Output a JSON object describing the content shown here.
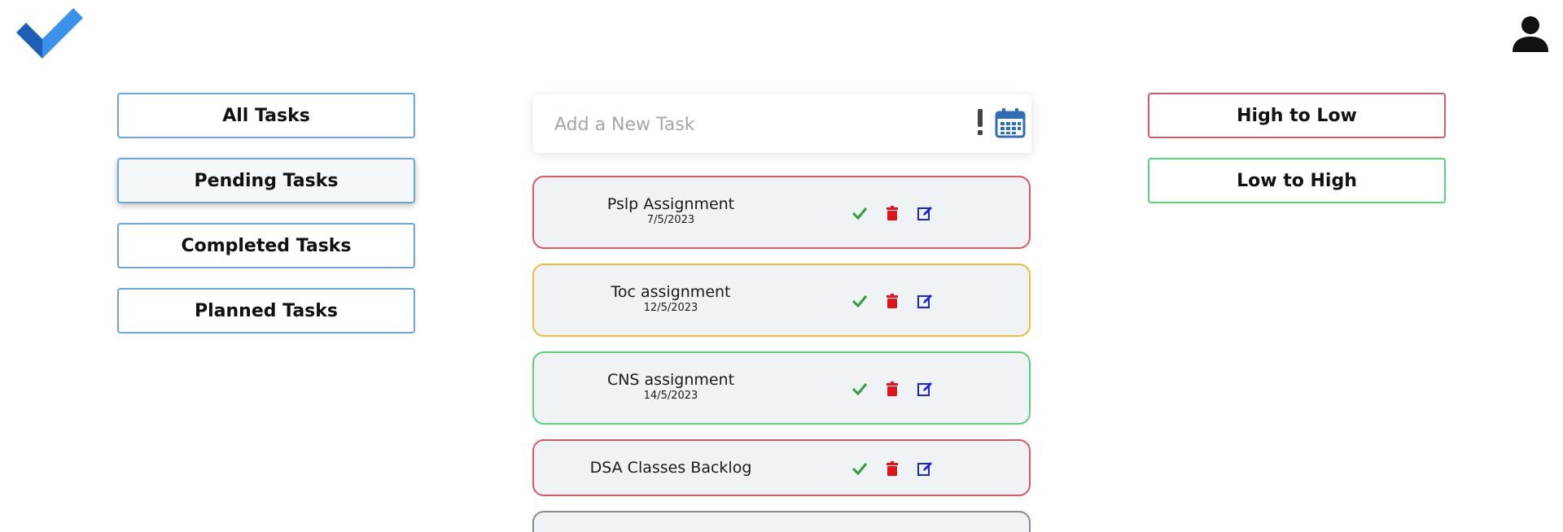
{
  "header": {
    "logo_icon": "checkmark-logo-icon",
    "user_icon": "user-icon"
  },
  "filters": {
    "all": "All Tasks",
    "pending": "Pending Tasks",
    "completed": "Completed Tasks",
    "planned": "Planned Tasks",
    "active": "pending"
  },
  "add_task": {
    "placeholder": "Add a New Task",
    "priority_icon": "exclamation-icon",
    "calendar_icon": "calendar-icon"
  },
  "sort": {
    "high_to_low": "High to Low",
    "low_to_high": "Low to High"
  },
  "tasks": [
    {
      "title": "Pslp Assignment",
      "date": "7/5/2023",
      "priority_color": "#d65a62"
    },
    {
      "title": "Toc assignment",
      "date": "12/5/2023",
      "priority_color": "#e6be3a"
    },
    {
      "title": "CNS assignment",
      "date": "14/5/2023",
      "priority_color": "#5ccf7a"
    },
    {
      "title": "DSA Classes Backlog",
      "date": "",
      "priority_color": "#d65a62"
    },
    {
      "title": "",
      "date": "",
      "priority_color": "#8a8a8a"
    }
  ],
  "task_actions": {
    "complete_icon": "check-icon",
    "delete_icon": "trash-icon",
    "edit_icon": "edit-icon"
  },
  "colors": {
    "filter_border": "#6fa4d6",
    "high_to_low_border": "#d65a62",
    "low_to_high_border": "#5ccf7a",
    "check_color": "#2e9e3e",
    "trash_color": "#e0141b",
    "edit_color": "#1c23d6",
    "calendar_color": "#2f6db8"
  }
}
